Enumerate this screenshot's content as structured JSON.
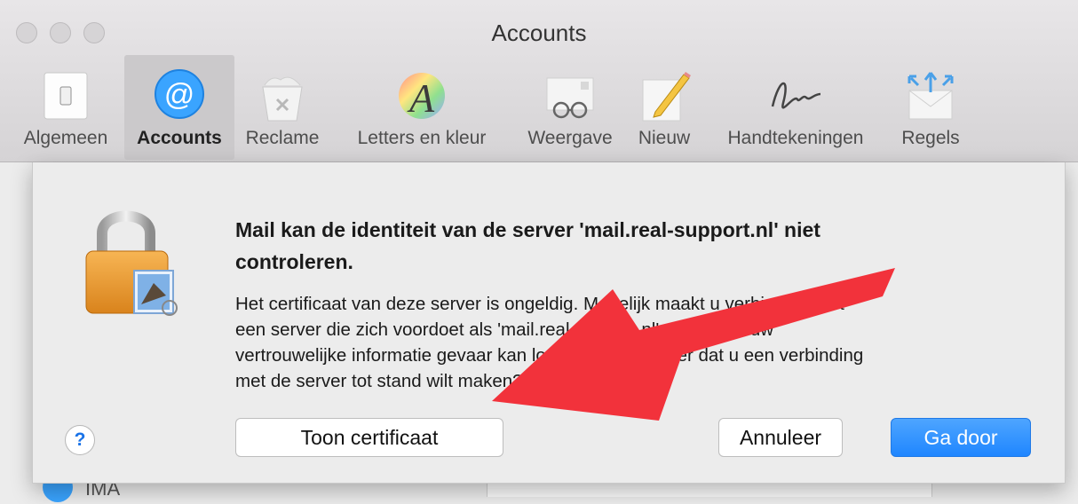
{
  "window": {
    "title": "Accounts"
  },
  "toolbar": {
    "items": [
      {
        "label": "Algemeen",
        "icon": "general-switch-icon"
      },
      {
        "label": "Accounts",
        "icon": "at-sign-icon",
        "active": true
      },
      {
        "label": "Reclame",
        "icon": "junk-bin-icon"
      },
      {
        "label": "Letters en kleur",
        "icon": "font-color-icon"
      },
      {
        "label": "Weergave",
        "icon": "glasses-icon"
      },
      {
        "label": "Nieuw",
        "icon": "pencil-note-icon"
      },
      {
        "label": "Handtekeningen",
        "icon": "signature-icon"
      },
      {
        "label": "Regels",
        "icon": "rules-envelope-icon"
      }
    ]
  },
  "dialog": {
    "headline_line1": "Mail kan de identiteit van de server 'mail.real-support.nl' niet",
    "headline_line2": "controleren.",
    "body_line1": "Het certificaat van deze server is ongeldig. Mogelijk maakt u verbinding met",
    "body_line2": "een server die zich voordoet als 'mail.real-support.nl', waardoor uw",
    "body_line3": "vertrouwelijke informatie gevaar kan lopen. Weet u zeker dat u een verbinding",
    "body_line4": "met de server tot stand wilt maken?",
    "help_label": "?",
    "show_cert_label": "Toon certificaat",
    "cancel_label": "Annuleer",
    "continue_label": "Ga door"
  },
  "behind": {
    "partial_label": "IMA"
  },
  "colors": {
    "accent": "#1f86ff",
    "annotation_arrow": "#f2323b"
  }
}
